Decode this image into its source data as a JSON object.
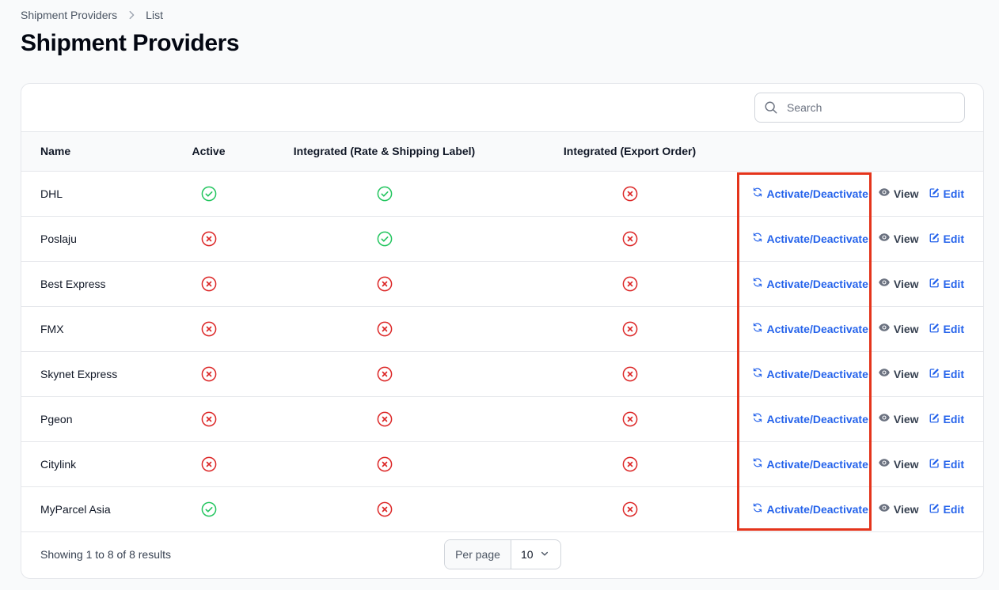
{
  "breadcrumb": [
    "Shipment Providers",
    "List"
  ],
  "page_title": "Shipment Providers",
  "search": {
    "placeholder": "Search",
    "value": ""
  },
  "columns": [
    "Name",
    "Active",
    "Integrated (Rate & Shipping Label)",
    "Integrated (Export Order)"
  ],
  "rows": [
    {
      "name": "DHL",
      "active": true,
      "rate": true,
      "export": false
    },
    {
      "name": "Poslaju",
      "active": false,
      "rate": true,
      "export": false
    },
    {
      "name": "Best Express",
      "active": false,
      "rate": false,
      "export": false
    },
    {
      "name": "FMX",
      "active": false,
      "rate": false,
      "export": false
    },
    {
      "name": "Skynet Express",
      "active": false,
      "rate": false,
      "export": false
    },
    {
      "name": "Pgeon",
      "active": false,
      "rate": false,
      "export": false
    },
    {
      "name": "Citylink",
      "active": false,
      "rate": false,
      "export": false
    },
    {
      "name": "MyParcel Asia",
      "active": true,
      "rate": false,
      "export": false
    }
  ],
  "row_actions": {
    "toggle": "Activate/Deactivate",
    "view": "View",
    "edit": "Edit"
  },
  "footer": {
    "results_text": "Showing 1 to 8 of 8 results",
    "per_page_label": "Per page",
    "per_page_value": "10"
  },
  "colors": {
    "accent": "#2563eb",
    "success": "#22c55e",
    "danger": "#dc2626",
    "highlight": "#e4341b"
  }
}
